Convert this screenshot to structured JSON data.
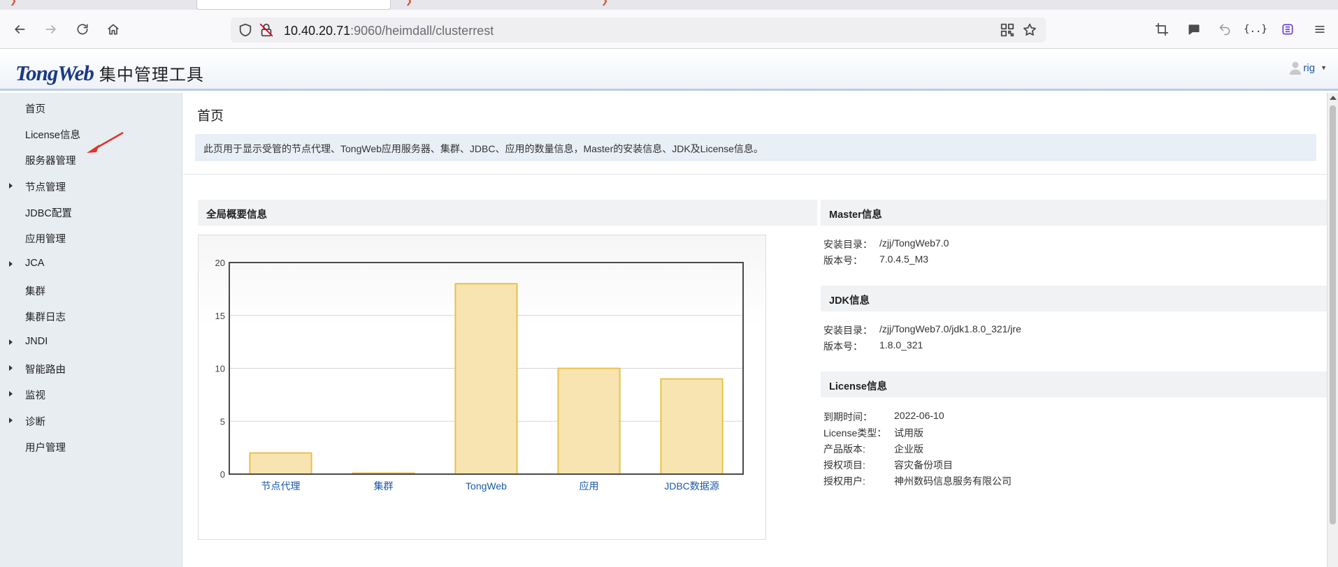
{
  "browser": {
    "url_host": "10.40.20.71",
    "url_rest": ":9060/heimdall/clusterrest"
  },
  "header": {
    "brand_logo": "TongWeb",
    "brand_subtitle": "集中管理工具",
    "user_name": "rig"
  },
  "sidebar": {
    "items": [
      {
        "label": "首页",
        "expandable": false
      },
      {
        "label": "License信息",
        "expandable": false
      },
      {
        "label": "服务器管理",
        "expandable": false
      },
      {
        "label": "节点管理",
        "expandable": true
      },
      {
        "label": "JDBC配置",
        "expandable": false
      },
      {
        "label": "应用管理",
        "expandable": false
      },
      {
        "label": "JCA",
        "expandable": true
      },
      {
        "label": "集群",
        "expandable": false
      },
      {
        "label": "集群日志",
        "expandable": false
      },
      {
        "label": "JNDI",
        "expandable": true
      },
      {
        "label": "智能路由",
        "expandable": true
      },
      {
        "label": "监视",
        "expandable": true
      },
      {
        "label": "诊断",
        "expandable": true
      },
      {
        "label": "用户管理",
        "expandable": false
      }
    ]
  },
  "main": {
    "title": "首页",
    "description": "此页用于显示受管的节点代理、TongWeb应用服务器、集群、JDBC、应用的数量信息，Master的安装信息、JDK及License信息。",
    "overview_title": "全局概要信息",
    "master": {
      "title": "Master信息",
      "rows": [
        {
          "key": "安装目录：",
          "value": "/zjj/TongWeb7.0"
        },
        {
          "key": "版本号：",
          "value": "7.0.4.5_M3"
        }
      ]
    },
    "jdk": {
      "title": "JDK信息",
      "rows": [
        {
          "key": "安装目录：",
          "value": "/zjj/TongWeb7.0/jdk1.8.0_321/jre"
        },
        {
          "key": "版本号：",
          "value": "1.8.0_321"
        }
      ]
    },
    "license": {
      "title": "License信息",
      "rows": [
        {
          "key": "到期时间：",
          "value": "2022-06-10"
        },
        {
          "key": "License类型：",
          "value": "试用版"
        },
        {
          "key": "产品版本:",
          "value": "企业版"
        },
        {
          "key": "授权项目:",
          "value": "容灾备份项目"
        },
        {
          "key": "授权用户:",
          "value": "神州数码信息服务有限公司"
        }
      ]
    }
  },
  "colors": {
    "bar_fill": "#f7e4b0",
    "bar_stroke": "#e8c14a",
    "tick_label": "#1a5aa8",
    "sidebar_bg": "#e8edf2",
    "annotation_arrow": "#e8302a"
  },
  "chart_data": {
    "type": "bar",
    "categories": [
      "节点代理",
      "集群",
      "TongWeb",
      "应用",
      "JDBC数据源"
    ],
    "values": [
      2,
      0,
      18,
      10,
      9
    ],
    "title": "",
    "xlabel": "",
    "ylabel": "",
    "ylim": [
      0,
      20
    ],
    "yticks": [
      0,
      5,
      10,
      15,
      20
    ],
    "grid": true
  }
}
